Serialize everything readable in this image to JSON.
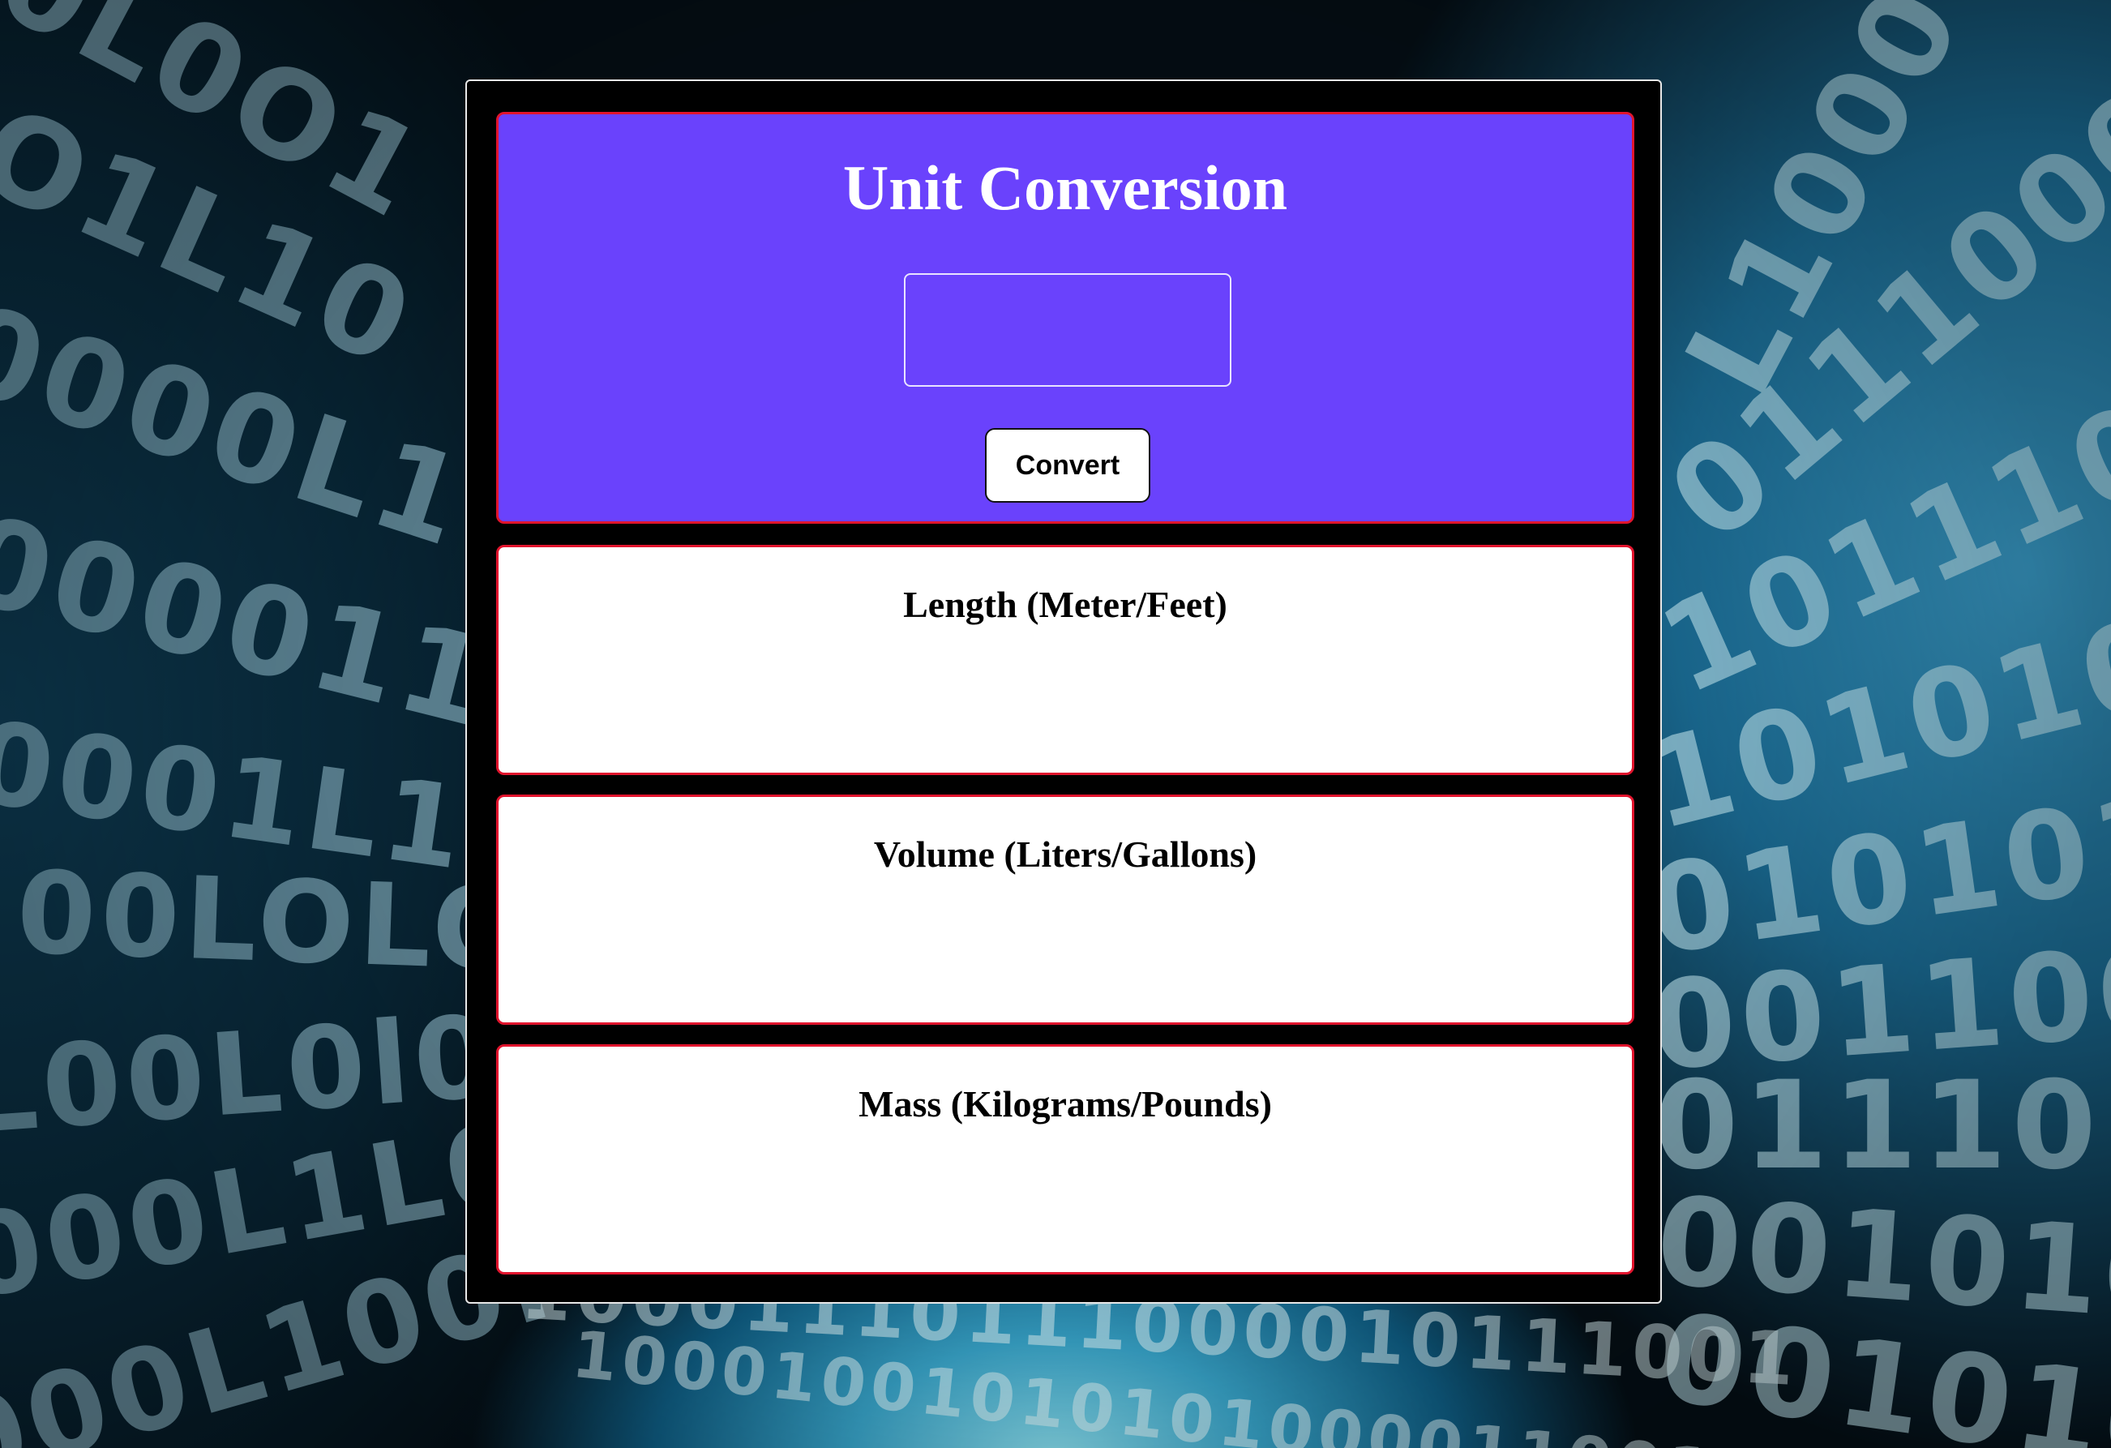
{
  "header": {
    "title": "Unit Conversion",
    "input_value": "",
    "convert_label": "Convert"
  },
  "cards": [
    {
      "title": "Length (Meter/Feet)",
      "result": ""
    },
    {
      "title": "Volume (Liters/Gallons)",
      "result": ""
    },
    {
      "title": "Mass (Kilograms/Pounds)",
      "result": ""
    }
  ],
  "colors": {
    "header_bg": "#6a42fc",
    "card_border": "#e1142d",
    "panel_bg": "#000000"
  },
  "background": {
    "image": "binary-digits-tunnel"
  }
}
